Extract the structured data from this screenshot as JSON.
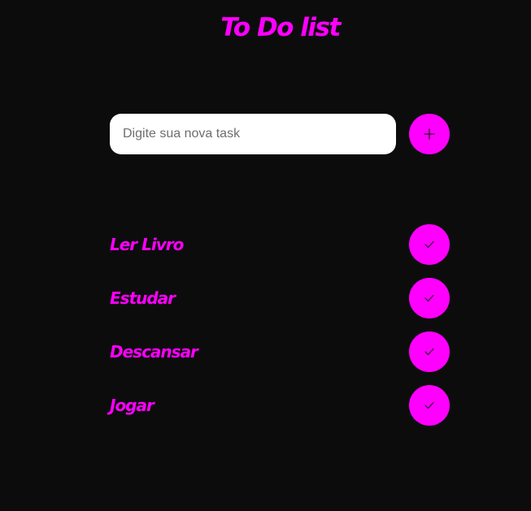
{
  "header": {
    "title": "To Do list"
  },
  "new_task": {
    "placeholder": "Digite sua nova task",
    "value": "",
    "add_icon": "plus-icon"
  },
  "tasks": [
    {
      "label": "Ler Livro",
      "icon": "check-icon"
    },
    {
      "label": "Estudar",
      "icon": "check-icon"
    },
    {
      "label": "Descansar",
      "icon": "check-icon"
    },
    {
      "label": "Jogar",
      "icon": "check-icon"
    }
  ],
  "colors": {
    "background": "#0c0c0d",
    "accent": "#ff00ff",
    "input_background": "#ffffff",
    "icon": "#3a1a3a"
  }
}
